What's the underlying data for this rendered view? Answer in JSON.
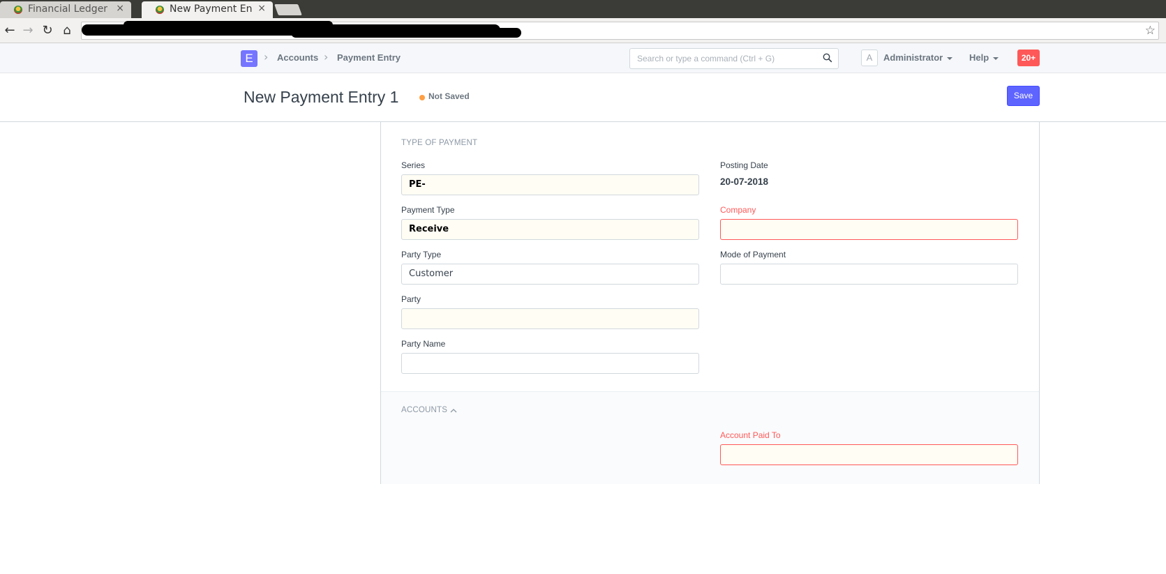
{
  "browser": {
    "tabs": [
      {
        "title": "Financial Ledger",
        "close": "×"
      },
      {
        "title": "New Payment Entry",
        "close": "×"
      }
    ]
  },
  "navbar": {
    "logo": "E",
    "breadcrumbs": [
      "Accounts",
      "Payment Entry"
    ],
    "search_placeholder": "Search or type a command (Ctrl + G)",
    "avatar_initial": "A",
    "user_label": "Administrator",
    "help_label": "Help",
    "notification_count": "20+"
  },
  "page": {
    "title": "New Payment Entry 1",
    "status": "Not Saved",
    "save_label": "Save",
    "status_color": "#ff9f43",
    "primary_color": "#5e64ff"
  },
  "form": {
    "section1_title": "TYPE OF PAYMENT",
    "series": {
      "label": "Series",
      "value": "PE-"
    },
    "payment_type": {
      "label": "Payment Type",
      "value": "Receive"
    },
    "party_type": {
      "label": "Party Type",
      "value": "Customer"
    },
    "party": {
      "label": "Party",
      "value": ""
    },
    "party_name": {
      "label": "Party Name",
      "value": ""
    },
    "posting_date": {
      "label": "Posting Date",
      "value": "20-07-2018"
    },
    "company": {
      "label": "Company",
      "value": ""
    },
    "mode_of_payment": {
      "label": "Mode of Payment",
      "value": ""
    },
    "section2_title": "ACCOUNTS",
    "account_paid_to": {
      "label": "Account Paid To",
      "value": ""
    }
  }
}
